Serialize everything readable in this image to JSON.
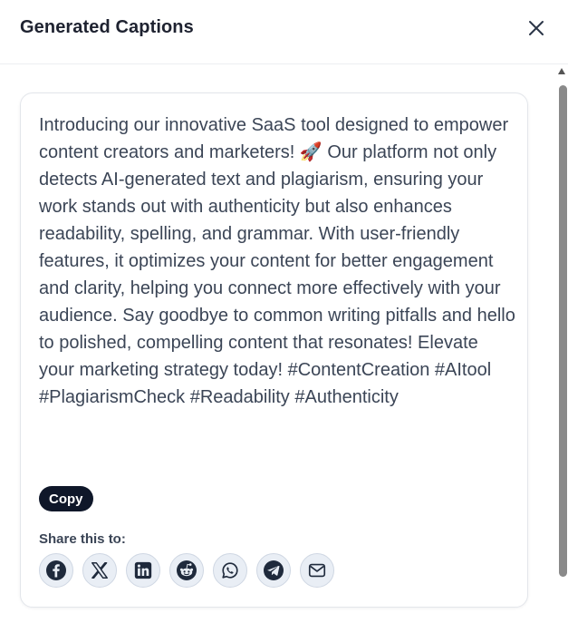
{
  "header": {
    "title": "Generated Captions",
    "close_icon": "close-icon"
  },
  "card": {
    "caption": "Introducing our innovative SaaS tool designed to empower content creators and marketers! 🚀 Our platform not only detects AI-generated text and plagiarism, ensuring your work stands out with authenticity but also enhances readability, spelling, and grammar. With user-friendly features, it optimizes your content for better engagement and clarity, helping you connect more effectively with your audience. Say goodbye to common writing pitfalls and hello to polished, compelling content that resonates! Elevate your marketing strategy today! #ContentCreation #AItool #PlagiarismCheck #Readability #Authenticity",
    "copy_label": "Copy",
    "share_label": "Share this to:",
    "share_icons": [
      "facebook-icon",
      "x-icon",
      "linkedin-icon",
      "reddit-icon",
      "whatsapp-icon",
      "telegram-icon",
      "email-icon"
    ]
  },
  "colors": {
    "title_text": "#1e2230",
    "caption_text": "#3b4556",
    "copy_button_bg": "#0f1729",
    "share_button_bg": "#e9eef5",
    "share_icon": "#1f2a3c"
  }
}
